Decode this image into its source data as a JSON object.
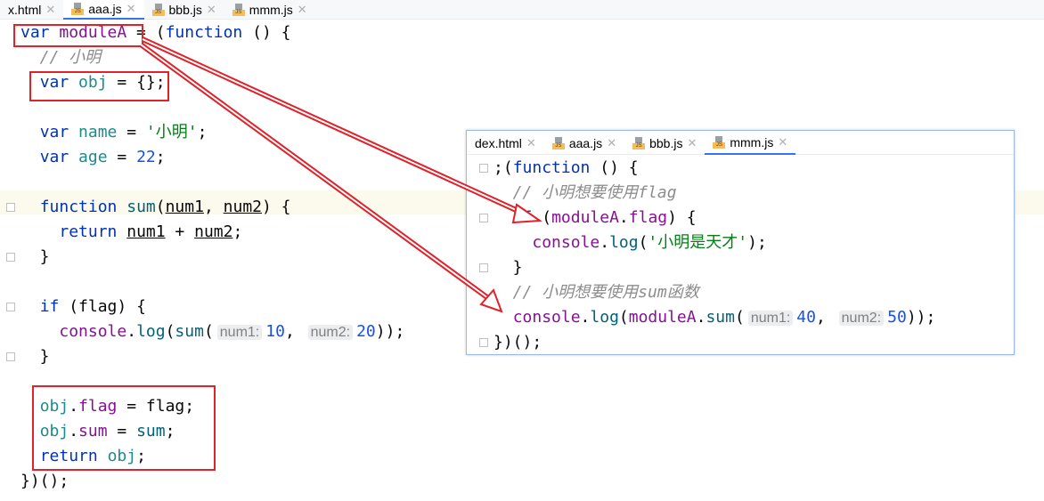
{
  "main_editor": {
    "tabs": [
      {
        "label": "x.html",
        "icon": "html-file-icon",
        "active": false
      },
      {
        "label": "aaa.js",
        "icon": "js-file-icon",
        "active": true
      },
      {
        "label": "bbb.js",
        "icon": "js-file-icon",
        "active": false
      },
      {
        "label": "mmm.js",
        "icon": "js-file-icon",
        "active": false
      }
    ],
    "lines": [
      [
        [
          "kw",
          "var"
        ],
        [
          "pl",
          " "
        ],
        [
          "pv",
          "moduleA"
        ],
        [
          "pl",
          " = ("
        ],
        [
          "kw",
          "function"
        ],
        [
          "pl",
          " () {"
        ]
      ],
      [
        [
          "cm",
          "  // 小明"
        ]
      ],
      [
        [
          "pl",
          "  "
        ],
        [
          "kw",
          "var"
        ],
        [
          "pl",
          " "
        ],
        [
          "lv",
          "obj"
        ],
        [
          "pl",
          " = {};"
        ]
      ],
      [],
      [
        [
          "pl",
          "  "
        ],
        [
          "kw",
          "var"
        ],
        [
          "pl",
          " "
        ],
        [
          "lv",
          "name"
        ],
        [
          "pl",
          " = "
        ],
        [
          "st",
          "'小明'"
        ],
        [
          "pl",
          ";"
        ]
      ],
      [
        [
          "pl",
          "  "
        ],
        [
          "kw",
          "var"
        ],
        [
          "pl",
          " "
        ],
        [
          "lv",
          "age"
        ],
        [
          "pl",
          " = "
        ],
        [
          "nm",
          "22"
        ],
        [
          "pl",
          ";"
        ]
      ],
      [],
      [
        [
          "pl",
          "  "
        ],
        [
          "kw",
          "function"
        ],
        [
          "pl",
          " "
        ],
        [
          "fn",
          "sum"
        ],
        [
          "pl",
          "("
        ],
        [
          "ul",
          "num1"
        ],
        [
          "pl",
          ", "
        ],
        [
          "ul",
          "num2"
        ],
        [
          "pl",
          ") {"
        ]
      ],
      [
        [
          "pl",
          "    "
        ],
        [
          "kw",
          "return"
        ],
        [
          "pl",
          " "
        ],
        [
          "ul",
          "num1"
        ],
        [
          "pl",
          " + "
        ],
        [
          "ul",
          "num2"
        ],
        [
          "pl",
          ";"
        ]
      ],
      [
        [
          "pl",
          "  }"
        ]
      ],
      [],
      [
        [
          "pl",
          "  "
        ],
        [
          "kw",
          "if"
        ],
        [
          "pl",
          " (flag) {"
        ]
      ],
      [
        [
          "pl",
          "    "
        ],
        [
          "pv",
          "console"
        ],
        [
          "pl",
          "."
        ],
        [
          "fn",
          "log"
        ],
        [
          "pl",
          "("
        ],
        [
          "fn",
          "sum"
        ],
        [
          "pl",
          "("
        ],
        [
          "hint",
          "num1:"
        ],
        [
          "nm",
          "10"
        ],
        [
          "pl",
          ", "
        ],
        [
          "hint",
          "num2:"
        ],
        [
          "nm",
          "20"
        ],
        [
          "pl",
          "));"
        ]
      ],
      [
        [
          "pl",
          "  }"
        ]
      ],
      [],
      [
        [
          "pl",
          "  "
        ],
        [
          "lv",
          "obj"
        ],
        [
          "pl",
          "."
        ],
        [
          "pv",
          "flag"
        ],
        [
          "pl",
          " = flag;"
        ]
      ],
      [
        [
          "pl",
          "  "
        ],
        [
          "lv",
          "obj"
        ],
        [
          "pl",
          "."
        ],
        [
          "pv",
          "sum"
        ],
        [
          "pl",
          " = "
        ],
        [
          "fn",
          "sum"
        ],
        [
          "pl",
          ";"
        ]
      ],
      [
        [
          "pl",
          "  "
        ],
        [
          "kw",
          "return"
        ],
        [
          "pl",
          " "
        ],
        [
          "lv",
          "obj"
        ],
        [
          "pl",
          ";"
        ]
      ],
      [
        [
          "pl",
          "})();"
        ]
      ]
    ]
  },
  "popup_editor": {
    "tabs": [
      {
        "label": "dex.html",
        "icon": "html-file-icon",
        "active": false
      },
      {
        "label": "aaa.js",
        "icon": "js-file-icon",
        "active": false
      },
      {
        "label": "bbb.js",
        "icon": "js-file-icon",
        "active": false
      },
      {
        "label": "mmm.js",
        "icon": "js-file-icon",
        "active": true
      }
    ],
    "lines": [
      [
        [
          "pl",
          ";("
        ],
        [
          "kw",
          "function"
        ],
        [
          "pl",
          " () {"
        ]
      ],
      [
        [
          "cm",
          "  // 小明想要使用flag"
        ]
      ],
      [
        [
          "pl",
          "  "
        ],
        [
          "kw",
          "if"
        ],
        [
          "pl",
          " ("
        ],
        [
          "pv",
          "moduleA"
        ],
        [
          "pl",
          "."
        ],
        [
          "pv",
          "flag"
        ],
        [
          "pl",
          ") {"
        ]
      ],
      [
        [
          "pl",
          "    "
        ],
        [
          "pv",
          "console"
        ],
        [
          "pl",
          "."
        ],
        [
          "fn",
          "log"
        ],
        [
          "pl",
          "("
        ],
        [
          "st",
          "'小明是天才'"
        ],
        [
          "pl",
          ");"
        ]
      ],
      [
        [
          "pl",
          "  }"
        ]
      ],
      [
        [
          "cm",
          "  // 小明想要使用sum函数"
        ]
      ],
      [
        [
          "pl",
          "  "
        ],
        [
          "pv",
          "console"
        ],
        [
          "pl",
          "."
        ],
        [
          "fn",
          "log"
        ],
        [
          "pl",
          "("
        ],
        [
          "pv",
          "moduleA"
        ],
        [
          "pl",
          "."
        ],
        [
          "fn",
          "sum"
        ],
        [
          "pl",
          "("
        ],
        [
          "hint",
          "num1:"
        ],
        [
          "nm",
          "40"
        ],
        [
          "pl",
          ", "
        ],
        [
          "hint",
          "num2:"
        ],
        [
          "nm",
          "50"
        ],
        [
          "pl",
          "));"
        ]
      ],
      [
        [
          "pl",
          "})();"
        ]
      ]
    ]
  },
  "annotation_color": "#e0222a"
}
